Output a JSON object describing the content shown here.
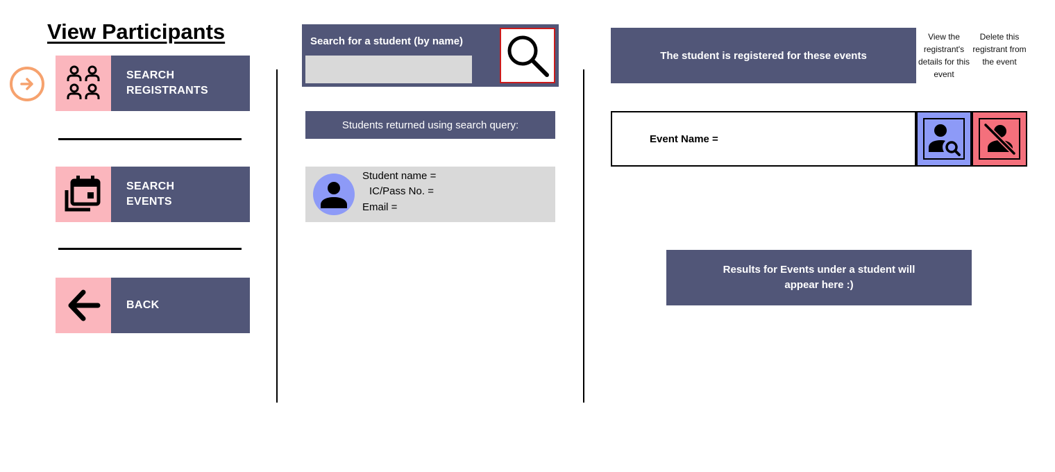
{
  "page": {
    "title": "View Participants"
  },
  "nav": {
    "items": [
      {
        "icon": "group-icon",
        "line1": "SEARCH",
        "line2": "REGISTRANTS",
        "active": true
      },
      {
        "icon": "calendar-events-icon",
        "line1": "SEARCH",
        "line2": "EVENTS",
        "active": false
      },
      {
        "icon": "arrow-left-icon",
        "line1": "BACK",
        "line2": "",
        "active": false
      }
    ],
    "current_marker_icon": "arrow-right-circle-icon"
  },
  "search": {
    "label": "Search for a student (by name)",
    "value": "",
    "placeholder": "",
    "button_icon": "search-icon"
  },
  "results": {
    "header": "Students returned using search query:",
    "student": {
      "avatar_icon": "person-icon",
      "name_label": "Student name =",
      "ic_label": "IC/Pass No. =",
      "email_label": "Email ="
    }
  },
  "events": {
    "header": "The student is registered for these events",
    "view_help": "View the registrant's details for this event",
    "delete_help": "Delete this registrant from the event",
    "row": {
      "name_label": "Event Name =",
      "view_icon": "person-search-icon",
      "delete_icon": "person-off-icon"
    },
    "empty_message": "Results for Events under a student will appear here :)"
  },
  "colors": {
    "panel": "#515678",
    "pink": "#fbb6bd",
    "periwinkle": "#8d9af7",
    "red": "#f4707c",
    "input_gray": "#d9d9d9",
    "marker_orange": "#f6a26e",
    "search_border": "#cc1b1b"
  }
}
